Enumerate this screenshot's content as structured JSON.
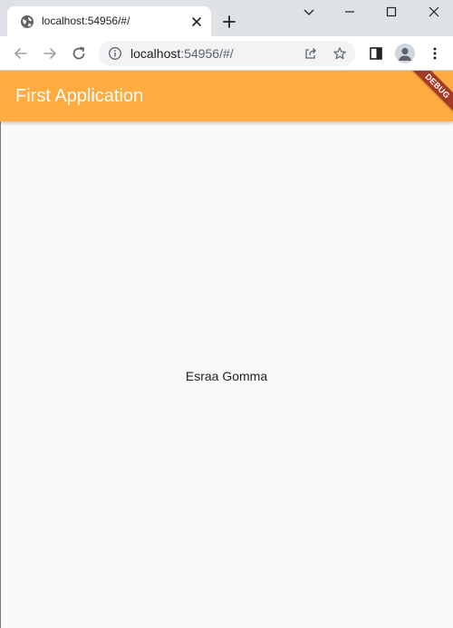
{
  "browser": {
    "tab": {
      "title": "localhost:54956/#/"
    },
    "address_bar": {
      "host": "localhost",
      "rest": ":54956/#/"
    },
    "icons": {
      "favicon": "globe-icon",
      "tab_close": "close-icon",
      "new_tab": "plus-icon",
      "window_controls": [
        "chevron-down-icon",
        "minimize-icon",
        "maximize-icon",
        "close-icon"
      ],
      "nav": [
        "back-arrow-icon",
        "forward-arrow-icon",
        "reload-icon"
      ],
      "omnibox": [
        "info-icon",
        "share-icon",
        "star-icon"
      ],
      "toolbar": [
        "side-panel-icon",
        "profile-avatar",
        "kebab-menu-icon"
      ]
    }
  },
  "app": {
    "appbar_title": "First Application",
    "appbar_color": "#ffab40",
    "debug_banner": "DEBUG",
    "debug_banner_color": "#a33a25",
    "body_text": "Esraa Gomma",
    "background_color": "#fafafa"
  }
}
